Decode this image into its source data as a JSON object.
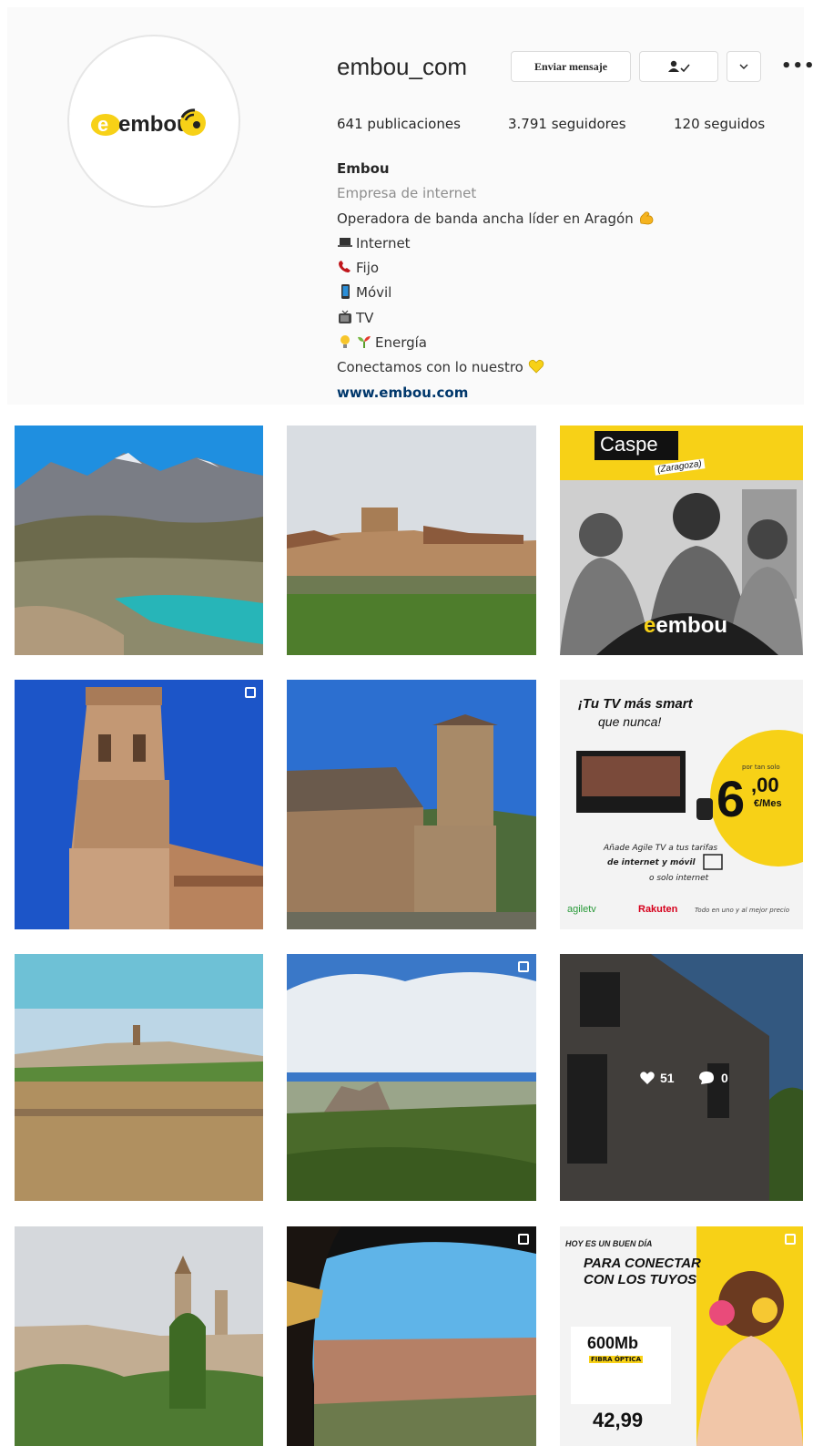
{
  "profile": {
    "username": "embou_com",
    "message_button": "Enviar mensaje",
    "posts_count": "641",
    "posts_label": "publicaciones",
    "followers_count": "3.791",
    "followers_label": "seguidores",
    "following_count": "120",
    "following_label": "seguidos",
    "logo_text": "embou"
  },
  "bio": {
    "name": "Embou",
    "category": "Empresa de internet",
    "line1": "Operadora de banda ancha líder en Aragón",
    "line2": "Internet",
    "line3": "Fijo",
    "line4": "Móvil",
    "line5": "TV",
    "line6": "Energía",
    "line7": "Conectamos con lo nuestro",
    "website": "www.embou.com"
  },
  "posts": {
    "p3_title": "Caspe",
    "p3_subtitle": "(Zaragoza)",
    "p3_brand": "embou",
    "p6_headline1": "¡Tu TV más smart",
    "p6_headline2": "que nunca!",
    "p6_price_prefix": "por tan solo",
    "p6_price_int": "6",
    "p6_price_dec": ",00",
    "p6_price_unit": "€/Mes",
    "p6_body1": "Añade Agile TV a tus tarifas",
    "p6_body2": "de internet y móvil",
    "p6_body3": "o solo internet",
    "p6_brand1": "agiletv",
    "p6_brand2": "Rakuten",
    "p6_tagline": "Todo en uno y al mejor precio",
    "p9_likes": "51",
    "p9_comments": "0",
    "p12_line1": "HOY ES UN BUEN DÍA",
    "p12_line2": "PARA CONECTAR",
    "p12_line3": "CON LOS TUYOS",
    "p12_speed": "600Mb",
    "p12_fiber": "FIBRA ÓPTICA",
    "p12_price": "42,99"
  },
  "colors": {
    "brand_yellow": "#f7d117",
    "link_blue": "#00376b",
    "muted": "#8e8e8e"
  }
}
